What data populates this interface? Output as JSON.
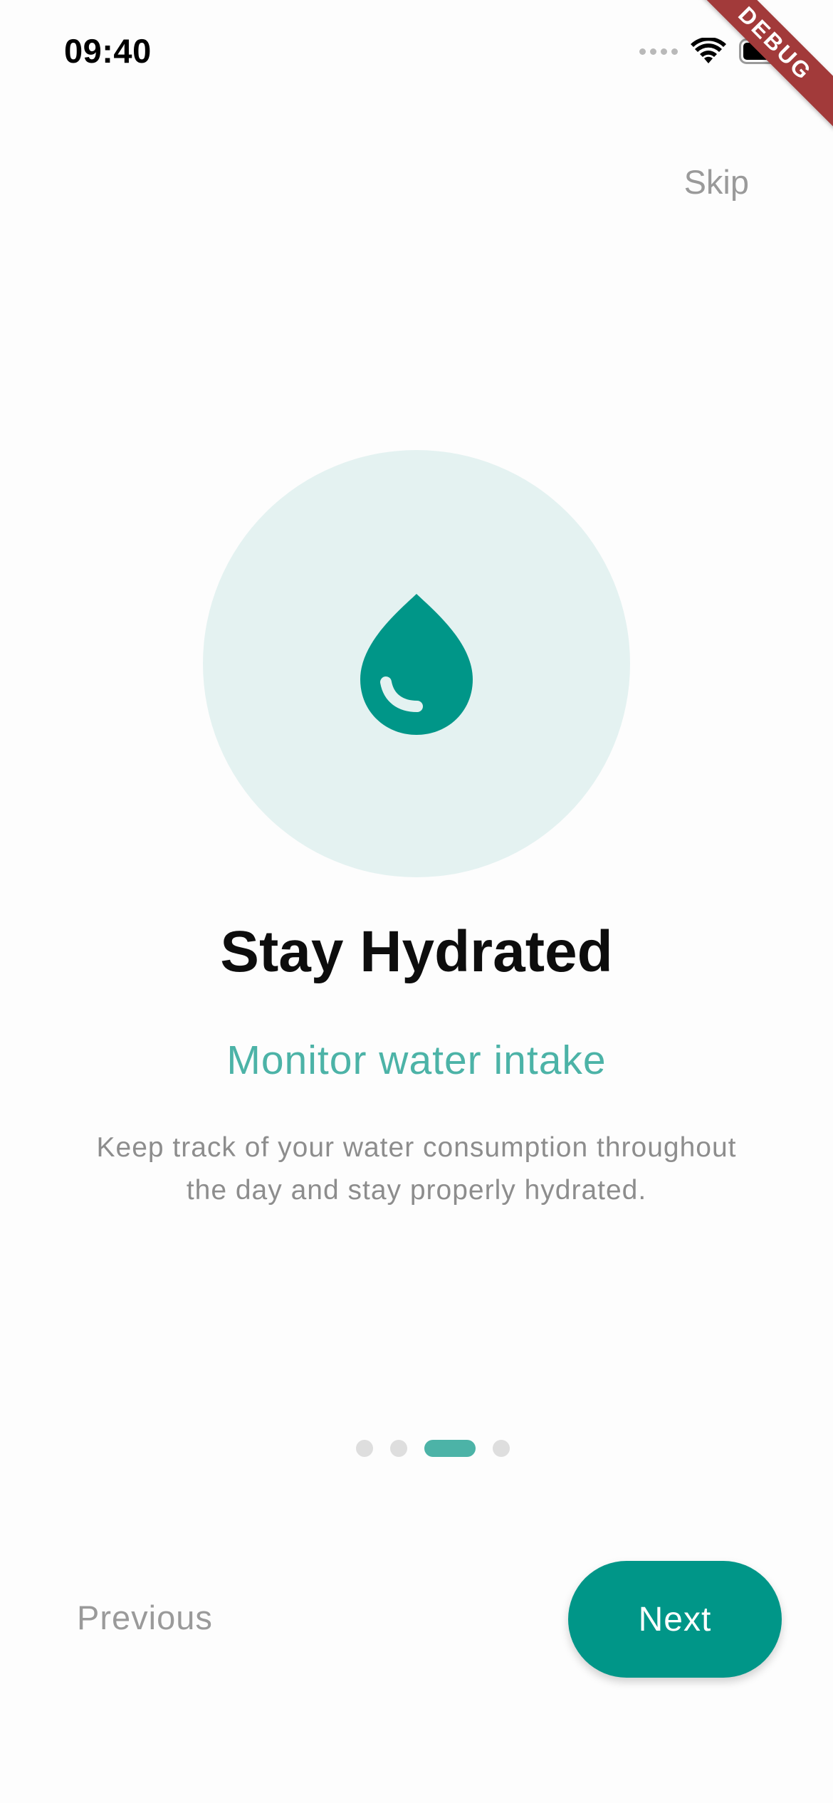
{
  "status_bar": {
    "time": "09:40",
    "icons": [
      "cellular-signal-icon",
      "wifi-icon",
      "battery-icon"
    ]
  },
  "debug_banner": "DEBUG",
  "header": {
    "skip_label": "Skip"
  },
  "illustration": {
    "icon": "water-drop-icon",
    "circle_color": "#e4f2f1",
    "icon_color": "#009688"
  },
  "content": {
    "title": "Stay Hydrated",
    "subtitle": "Monitor water intake",
    "description_line1": "Keep track of your water consumption throughout",
    "description_line2": "the day and stay properly hydrated."
  },
  "pager": {
    "total_pages": 4,
    "current_page": 3
  },
  "footer": {
    "previous_label": "Previous",
    "next_label": "Next"
  },
  "colors": {
    "accent": "#009688",
    "accent_light": "#4cb3a7",
    "muted_text": "#9a9a9a"
  }
}
